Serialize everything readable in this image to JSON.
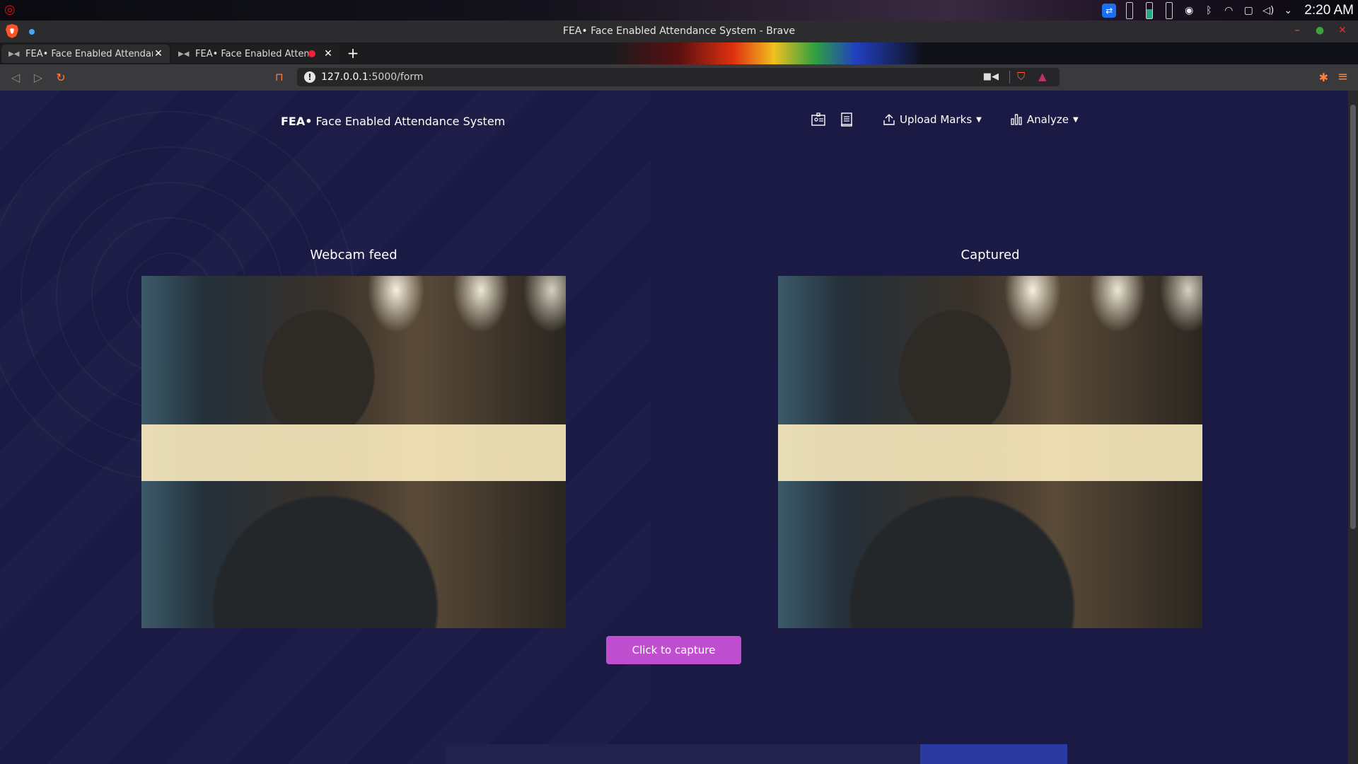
{
  "os": {
    "clock": "2:20 AM",
    "tray_icons": [
      "teamviewer-icon",
      "battery-icon",
      "battery-icon",
      "battery-icon",
      "accessibility-icon",
      "bluetooth-icon",
      "wifi-icon",
      "screen-icon",
      "volume-icon",
      "chevron-down-icon"
    ]
  },
  "window": {
    "title": "FEA• Face Enabled Attendance System - Brave"
  },
  "tabs": [
    {
      "label": "FEA• Face Enabled Attendance System",
      "active": true
    },
    {
      "label": "FEA• Face Enabled Attendance System",
      "active": false,
      "recording": true
    }
  ],
  "address": {
    "host": "127.0.0.1",
    "path": ":5000/form"
  },
  "colors": {
    "page_bg": "#1a1a45",
    "button_bg": "#c04fd0",
    "browser_accent": "#ff8040"
  },
  "app": {
    "brand_bold": "FEA•",
    "brand_rest": " Face Enabled Attendance System",
    "nav": {
      "icon1": "id-card-icon",
      "icon2": "document-icon",
      "upload_label": "Upload Marks",
      "analyze_label": "Analyze"
    },
    "webcam_title": "Webcam feed",
    "captured_title": "Captured",
    "capture_button": "Click to capture"
  }
}
